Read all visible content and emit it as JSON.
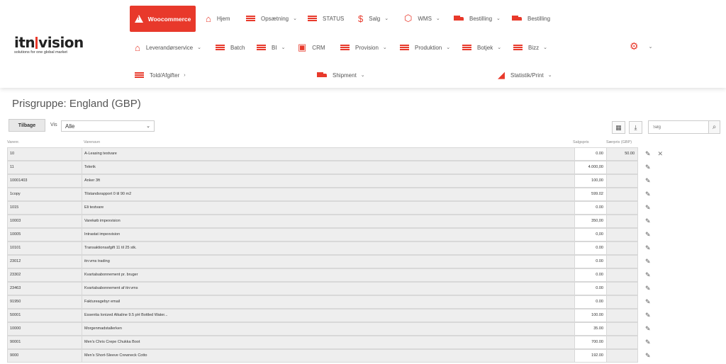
{
  "logo": {
    "main_left": "itn",
    "main_right": "vision",
    "tagline": "solutions for one global market"
  },
  "nav": {
    "woocommerce": "Woocommerce",
    "hjem": "Hjem",
    "opsaetning": "Opsætning",
    "status": "STATUS",
    "salg": "Salg",
    "wms": "WMS",
    "bestilling1": "Bestilling",
    "bestilling2": "Bestilling",
    "leverandorservice": "Leverandørservice",
    "batch": "Batch",
    "bi": "BI",
    "crm": "CRM",
    "provision": "Provision",
    "produktion": "Produktion",
    "botjek": "Botjek",
    "bizz": "Bizz",
    "told": "Told/Afgifter",
    "shipment": "Shipment",
    "statistik": "Statistik/Print"
  },
  "page": {
    "title": "Prisgruppe: England (GBP)"
  },
  "toolbar": {
    "back_label": "Tilbage",
    "vis_label": "Vis",
    "vis_value": "Alle",
    "search_placeholder": "Søg"
  },
  "table": {
    "headers": {
      "nr": "Varenr.",
      "name": "Varenavn",
      "price": "Salgspris",
      "special": "Særpris (GBP)"
    },
    "rows": [
      {
        "nr": "10",
        "name": "A-Leasing testvare",
        "price": "0.00",
        "special": "50.00"
      },
      {
        "nr": "11",
        "name": "Telerik",
        "price": "4.000,00",
        "special": ""
      },
      {
        "nr": "10001403",
        "name": "Anker 3ft",
        "price": "100,00",
        "special": ""
      },
      {
        "nr": "1copy",
        "name": "Tilstandsrapport 0 til 90 m2",
        "price": "599.02",
        "special": ""
      },
      {
        "nr": "1015",
        "name": "Eli testvare",
        "price": "0.00",
        "special": ""
      },
      {
        "nr": "10003",
        "name": "Varekøb impexvision",
        "price": "350,00",
        "special": ""
      },
      {
        "nr": "10005",
        "name": "Intrastat impexvision",
        "price": "0,00",
        "special": ""
      },
      {
        "nr": "10101",
        "name": "Transaktionsafgift 11 til 25 stk.",
        "price": "0.00",
        "special": ""
      },
      {
        "nr": "23012",
        "name": "itn:vms trading",
        "price": "0.00",
        "special": ""
      },
      {
        "nr": "23302",
        "name": "Kvartalsabonnement pr. bruger",
        "price": "0.00",
        "special": ""
      },
      {
        "nr": "23463",
        "name": "Kvartalsabonnement af itn:vms",
        "price": "0.00",
        "special": ""
      },
      {
        "nr": "91950",
        "name": "Faktureagebyr email",
        "price": "0.00",
        "special": ""
      },
      {
        "nr": "50001",
        "name": "Essentia Ionized Alkaline 9.5 pH Bottled Water...",
        "price": "100.00",
        "special": ""
      },
      {
        "nr": "10000",
        "name": "Morgenmadstallerken",
        "price": "35.00",
        "special": ""
      },
      {
        "nr": "90001",
        "name": "Men's Chris Crepe Chukka Boot",
        "price": "700.00",
        "special": ""
      },
      {
        "nr": "9000",
        "name": "Men's Short-Sleeve Crewneck Cotto",
        "price": "192.00",
        "special": ""
      }
    ]
  },
  "colors": {
    "accent": "#e8392b"
  }
}
